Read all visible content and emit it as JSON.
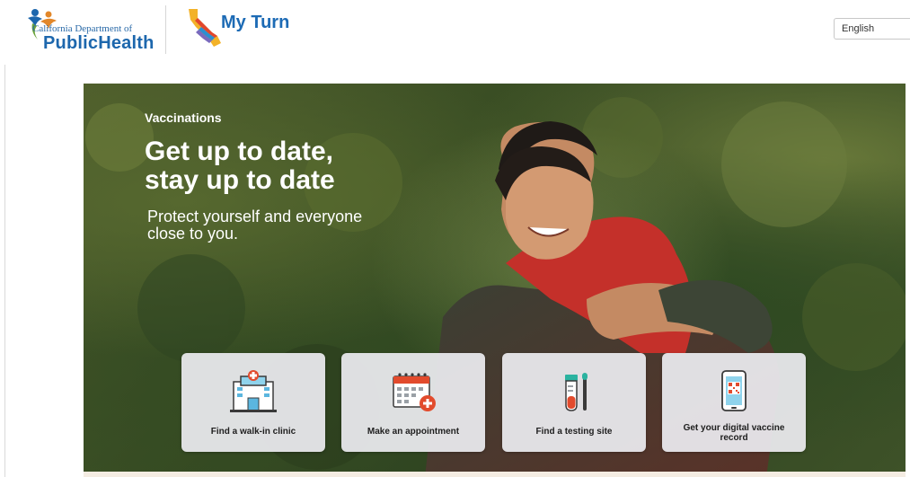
{
  "header": {
    "cdph_line1": "California Department of",
    "cdph_line2": "PublicHealth",
    "myturn_brand": "My Turn",
    "language_selected": "English"
  },
  "hero": {
    "eyebrow": "Vaccinations",
    "headline_line1": "Get up to date,",
    "headline_line2": "stay up to date",
    "subhead_line1": "Protect yourself and everyone",
    "subhead_line2": "close to you."
  },
  "actions": [
    {
      "label": "Find a walk-in clinic",
      "icon": "clinic-building-icon"
    },
    {
      "label": "Make an appointment",
      "icon": "calendar-add-icon"
    },
    {
      "label": "Find a testing site",
      "icon": "test-tube-swab-icon"
    },
    {
      "label_line1": "Get your digital vaccine",
      "label_line2": "record",
      "icon": "phone-qr-code-icon"
    }
  ],
  "colors": {
    "brand_blue": "#1d6bb5",
    "card_bg": "#ececf0"
  }
}
